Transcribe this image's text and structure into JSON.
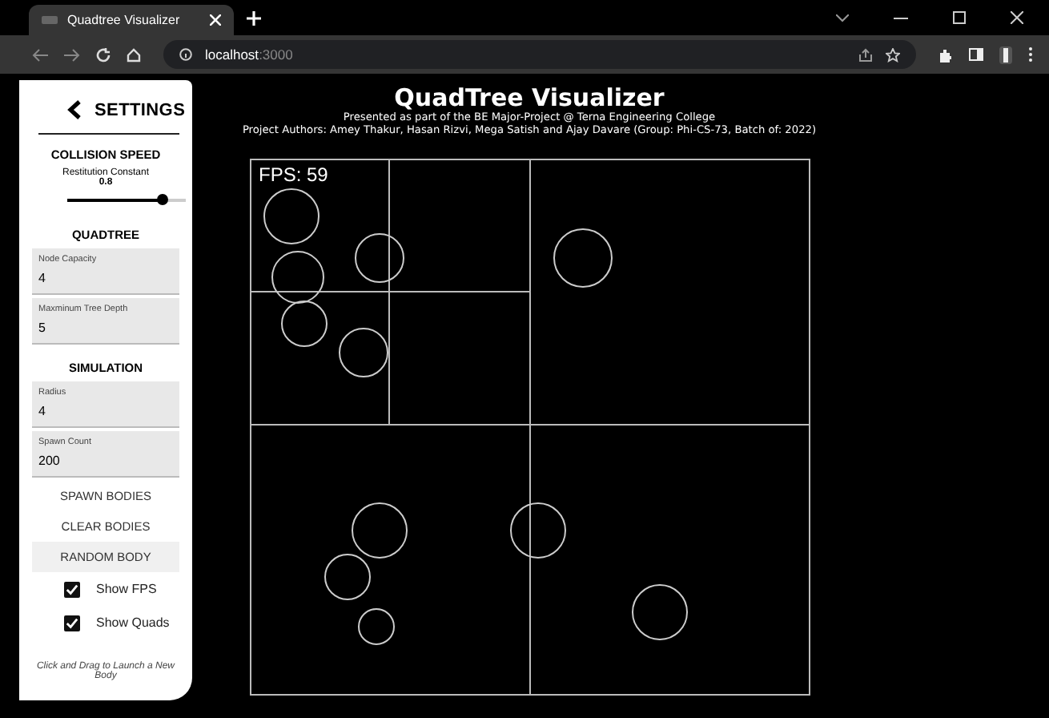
{
  "browser": {
    "tab": {
      "title": "Quadtree Visualizer",
      "selected": true
    },
    "address": {
      "host": "localhost",
      "port": ":3000"
    }
  },
  "sidebar": {
    "title": "SETTINGS",
    "sections": [
      {
        "heading": "COLLISION SPEED",
        "items": [
          {
            "kind": "slider",
            "label": "Restitution Constant",
            "reading": "0.8",
            "level": 0.8
          }
        ]
      },
      {
        "heading": "QUADTREE",
        "items": [
          {
            "kind": "field",
            "label": "Node Capacity",
            "value": "4"
          },
          {
            "kind": "field",
            "label": "Maxminum Tree Depth",
            "value": "5"
          }
        ]
      },
      {
        "heading": "SIMULATION",
        "items": [
          {
            "kind": "field",
            "label": "Radius",
            "value": "4"
          },
          {
            "kind": "field",
            "label": "Spawn Count",
            "value": "200"
          },
          {
            "kind": "button",
            "label": "SPAWN BODIES",
            "hovered": false
          },
          {
            "kind": "button",
            "label": "CLEAR BODIES",
            "hovered": false
          },
          {
            "kind": "button",
            "label": "RANDOM BODY",
            "hovered": true
          },
          {
            "kind": "checkbox",
            "label": "Show FPS",
            "checked": true
          },
          {
            "kind": "checkbox",
            "label": "Show Quads",
            "checked": true
          }
        ]
      }
    ],
    "note": "Click and Drag to Launch a New Body"
  },
  "main": {
    "title": "QuadTree Visualizer",
    "subtitle": "Presented as part of the BE Major-Project @ Terna Engineering College",
    "authors": "Project Authors: Amey Thakur, Hasan Rizvi, Mega Satish and Ajay Davare (Group: Phi-CS-73, Batch of: 2022)",
    "fps": "FPS: 59"
  }
}
